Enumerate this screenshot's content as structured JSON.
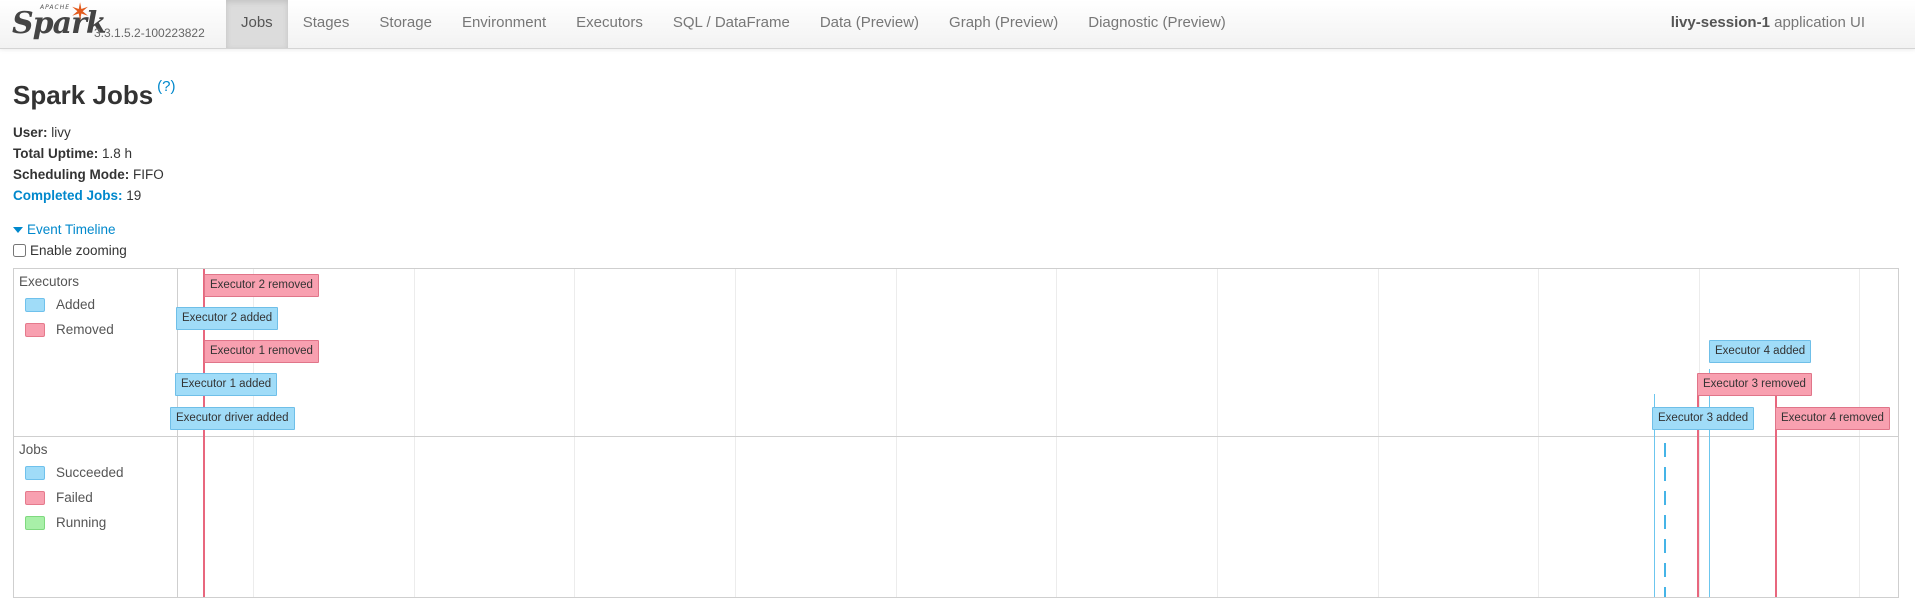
{
  "navbar": {
    "brand_apache": "APACHE",
    "brand_name": "Spark",
    "version": "3.3.1.5.2-100223822",
    "links": [
      {
        "label": "Jobs",
        "active": true
      },
      {
        "label": "Stages"
      },
      {
        "label": "Storage"
      },
      {
        "label": "Environment"
      },
      {
        "label": "Executors"
      },
      {
        "label": "SQL / DataFrame"
      },
      {
        "label": "Data (Preview)"
      },
      {
        "label": "Graph (Preview)"
      },
      {
        "label": "Diagnostic (Preview)"
      }
    ],
    "app_name": "livy-session-1",
    "app_suffix": "application UI"
  },
  "page": {
    "title": "Spark Jobs",
    "help": "(?)"
  },
  "info": {
    "user_label": "User:",
    "user_value": "livy",
    "uptime_label": "Total Uptime:",
    "uptime_value": "1.8 h",
    "scheduling_label": "Scheduling Mode:",
    "scheduling_value": "FIFO",
    "completed_label": "Completed Jobs:",
    "completed_value": "19"
  },
  "timeline": {
    "toggle_label": "Event Timeline",
    "zoom_label": "Enable zooming",
    "zoom_checked": false,
    "executors_group": {
      "title": "Executors",
      "legend": [
        {
          "label": "Added",
          "color": "#a0dcf8"
        },
        {
          "label": "Removed",
          "color": "#f8a0b0"
        }
      ]
    },
    "jobs_group": {
      "title": "Jobs",
      "legend": [
        {
          "label": "Succeeded",
          "color": "#a0dcf8"
        },
        {
          "label": "Failed",
          "color": "#f8a0b0"
        },
        {
          "label": "Running",
          "color": "#a8f0a8"
        }
      ]
    },
    "events": [
      "Executor 2 removed",
      "Executor 2 added",
      "Executor 1 removed",
      "Executor 1 added",
      "Executor driver added",
      "Executor 4 added",
      "Executor 3 removed",
      "Executor 3 added",
      "Executor 4 removed"
    ]
  },
  "colors": {
    "added": "#a0dcf8",
    "removed": "#f8a0b0",
    "link": "#0088cc",
    "spark_orange": "#e25a1c"
  }
}
